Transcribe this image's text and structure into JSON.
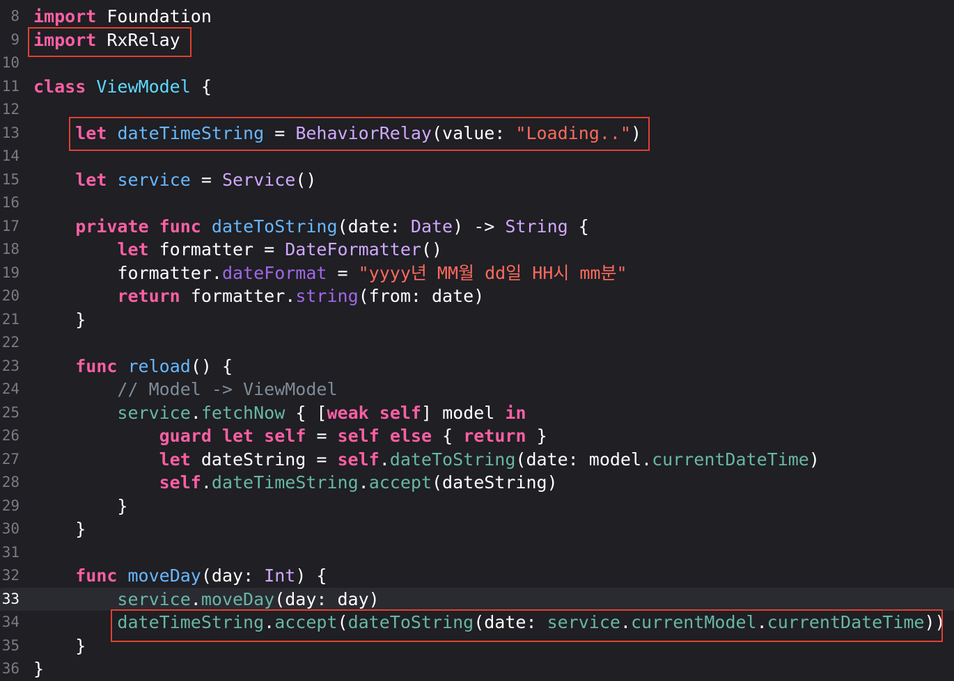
{
  "editor": {
    "current_line": "33",
    "lines": [
      {
        "n": "8",
        "tokens": [
          {
            "t": "import",
            "c": "kw"
          },
          {
            "t": " Foundation",
            "c": "plain"
          }
        ]
      },
      {
        "n": "9",
        "tokens": [
          {
            "t": "import",
            "c": "kw"
          },
          {
            "t": " RxRelay",
            "c": "plain"
          }
        ]
      },
      {
        "n": "10",
        "tokens": []
      },
      {
        "n": "11",
        "tokens": [
          {
            "t": "class",
            "c": "kw"
          },
          {
            "t": " ",
            "c": "plain"
          },
          {
            "t": "ViewModel",
            "c": "type"
          },
          {
            "t": " {",
            "c": "plain"
          }
        ]
      },
      {
        "n": "12",
        "tokens": []
      },
      {
        "n": "13",
        "tokens": [
          {
            "t": "    ",
            "c": "plain"
          },
          {
            "t": "let",
            "c": "kw"
          },
          {
            "t": " ",
            "c": "plain"
          },
          {
            "t": "dateTimeString",
            "c": "id"
          },
          {
            "t": " = ",
            "c": "plain"
          },
          {
            "t": "BehaviorRelay",
            "c": "cls"
          },
          {
            "t": "(value: ",
            "c": "plain"
          },
          {
            "t": "\"Loading..\"",
            "c": "str"
          },
          {
            "t": ")",
            "c": "plain"
          }
        ]
      },
      {
        "n": "14",
        "tokens": []
      },
      {
        "n": "15",
        "tokens": [
          {
            "t": "    ",
            "c": "plain"
          },
          {
            "t": "let",
            "c": "kw"
          },
          {
            "t": " ",
            "c": "plain"
          },
          {
            "t": "service",
            "c": "id"
          },
          {
            "t": " = ",
            "c": "plain"
          },
          {
            "t": "Service",
            "c": "cls"
          },
          {
            "t": "()",
            "c": "plain"
          }
        ]
      },
      {
        "n": "16",
        "tokens": []
      },
      {
        "n": "17",
        "tokens": [
          {
            "t": "    ",
            "c": "plain"
          },
          {
            "t": "private",
            "c": "kw"
          },
          {
            "t": " ",
            "c": "plain"
          },
          {
            "t": "func",
            "c": "kw"
          },
          {
            "t": " ",
            "c": "plain"
          },
          {
            "t": "dateToString",
            "c": "id"
          },
          {
            "t": "(date: ",
            "c": "plain"
          },
          {
            "t": "Date",
            "c": "cls"
          },
          {
            "t": ") -> ",
            "c": "plain"
          },
          {
            "t": "String",
            "c": "cls"
          },
          {
            "t": " {",
            "c": "plain"
          }
        ]
      },
      {
        "n": "18",
        "tokens": [
          {
            "t": "        ",
            "c": "plain"
          },
          {
            "t": "let",
            "c": "kw"
          },
          {
            "t": " formatter = ",
            "c": "plain"
          },
          {
            "t": "DateFormatter",
            "c": "cls"
          },
          {
            "t": "()",
            "c": "plain"
          }
        ]
      },
      {
        "n": "19",
        "tokens": [
          {
            "t": "        formatter.",
            "c": "plain"
          },
          {
            "t": "dateFormat",
            "c": "call"
          },
          {
            "t": " = ",
            "c": "plain"
          },
          {
            "t": "\"yyyy년 MM월 dd일 HH시 mm분\"",
            "c": "str"
          }
        ]
      },
      {
        "n": "20",
        "tokens": [
          {
            "t": "        ",
            "c": "plain"
          },
          {
            "t": "return",
            "c": "kw"
          },
          {
            "t": " formatter.",
            "c": "plain"
          },
          {
            "t": "string",
            "c": "call"
          },
          {
            "t": "(from: date)",
            "c": "plain"
          }
        ]
      },
      {
        "n": "21",
        "tokens": [
          {
            "t": "    }",
            "c": "plain"
          }
        ]
      },
      {
        "n": "22",
        "tokens": []
      },
      {
        "n": "23",
        "tokens": [
          {
            "t": "    ",
            "c": "plain"
          },
          {
            "t": "func",
            "c": "kw"
          },
          {
            "t": " ",
            "c": "plain"
          },
          {
            "t": "reload",
            "c": "id"
          },
          {
            "t": "() {",
            "c": "plain"
          }
        ]
      },
      {
        "n": "24",
        "tokens": [
          {
            "t": "        ",
            "c": "plain"
          },
          {
            "t": "// Model -> ViewModel",
            "c": "com"
          }
        ]
      },
      {
        "n": "25",
        "tokens": [
          {
            "t": "        ",
            "c": "plain"
          },
          {
            "t": "service",
            "c": "prop"
          },
          {
            "t": ".",
            "c": "plain"
          },
          {
            "t": "fetchNow",
            "c": "prop"
          },
          {
            "t": " { [",
            "c": "plain"
          },
          {
            "t": "weak",
            "c": "kw"
          },
          {
            "t": " ",
            "c": "plain"
          },
          {
            "t": "self",
            "c": "kw"
          },
          {
            "t": "] model ",
            "c": "plain"
          },
          {
            "t": "in",
            "c": "kw"
          }
        ]
      },
      {
        "n": "26",
        "tokens": [
          {
            "t": "            ",
            "c": "plain"
          },
          {
            "t": "guard",
            "c": "kw"
          },
          {
            "t": " ",
            "c": "plain"
          },
          {
            "t": "let",
            "c": "kw"
          },
          {
            "t": " ",
            "c": "plain"
          },
          {
            "t": "self",
            "c": "kw"
          },
          {
            "t": " = ",
            "c": "plain"
          },
          {
            "t": "self",
            "c": "kw"
          },
          {
            "t": " ",
            "c": "plain"
          },
          {
            "t": "else",
            "c": "kw"
          },
          {
            "t": " { ",
            "c": "plain"
          },
          {
            "t": "return",
            "c": "kw"
          },
          {
            "t": " }",
            "c": "plain"
          }
        ]
      },
      {
        "n": "27",
        "tokens": [
          {
            "t": "            ",
            "c": "plain"
          },
          {
            "t": "let",
            "c": "kw"
          },
          {
            "t": " dateString = ",
            "c": "plain"
          },
          {
            "t": "self",
            "c": "kw"
          },
          {
            "t": ".",
            "c": "plain"
          },
          {
            "t": "dateToString",
            "c": "prop"
          },
          {
            "t": "(date: model.",
            "c": "plain"
          },
          {
            "t": "currentDateTime",
            "c": "prop"
          },
          {
            "t": ")",
            "c": "plain"
          }
        ]
      },
      {
        "n": "28",
        "tokens": [
          {
            "t": "            ",
            "c": "plain"
          },
          {
            "t": "self",
            "c": "kw"
          },
          {
            "t": ".",
            "c": "plain"
          },
          {
            "t": "dateTimeString",
            "c": "prop"
          },
          {
            "t": ".",
            "c": "plain"
          },
          {
            "t": "accept",
            "c": "prop"
          },
          {
            "t": "(dateString)",
            "c": "plain"
          }
        ]
      },
      {
        "n": "29",
        "tokens": [
          {
            "t": "        }",
            "c": "plain"
          }
        ]
      },
      {
        "n": "30",
        "tokens": [
          {
            "t": "    }",
            "c": "plain"
          }
        ]
      },
      {
        "n": "31",
        "tokens": []
      },
      {
        "n": "32",
        "tokens": [
          {
            "t": "    ",
            "c": "plain"
          },
          {
            "t": "func",
            "c": "kw"
          },
          {
            "t": " ",
            "c": "plain"
          },
          {
            "t": "moveDay",
            "c": "id"
          },
          {
            "t": "(day: ",
            "c": "plain"
          },
          {
            "t": "Int",
            "c": "cls"
          },
          {
            "t": ") {",
            "c": "plain"
          }
        ]
      },
      {
        "n": "33",
        "tokens": [
          {
            "t": "        ",
            "c": "plain"
          },
          {
            "t": "service",
            "c": "prop"
          },
          {
            "t": ".",
            "c": "plain"
          },
          {
            "t": "moveDay",
            "c": "prop"
          },
          {
            "t": "(day: day)",
            "c": "plain"
          }
        ]
      },
      {
        "n": "34",
        "tokens": [
          {
            "t": "        ",
            "c": "plain"
          },
          {
            "t": "dateTimeString",
            "c": "prop"
          },
          {
            "t": ".",
            "c": "plain"
          },
          {
            "t": "accept",
            "c": "prop"
          },
          {
            "t": "(",
            "c": "plain"
          },
          {
            "t": "dateToString",
            "c": "prop"
          },
          {
            "t": "(date: ",
            "c": "plain"
          },
          {
            "t": "service",
            "c": "prop"
          },
          {
            "t": ".",
            "c": "plain"
          },
          {
            "t": "currentModel",
            "c": "prop"
          },
          {
            "t": ".",
            "c": "plain"
          },
          {
            "t": "currentDateTime",
            "c": "prop"
          },
          {
            "t": "))",
            "c": "plain"
          }
        ]
      },
      {
        "n": "35",
        "tokens": [
          {
            "t": "    }",
            "c": "plain"
          }
        ]
      },
      {
        "n": "36",
        "tokens": [
          {
            "t": "}",
            "c": "plain"
          }
        ]
      }
    ],
    "highlight_color": "#e1412f"
  }
}
